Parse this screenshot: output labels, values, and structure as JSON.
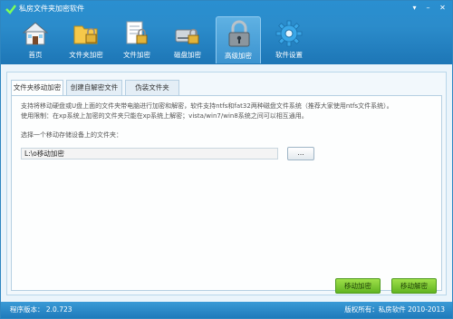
{
  "window": {
    "title": "私房文件夹加密软件",
    "controls": [
      "▾",
      "–",
      "✕"
    ]
  },
  "toolbar": {
    "items": [
      {
        "label": "首页",
        "icon": "house-icon"
      },
      {
        "label": "文件夹加密",
        "icon": "folder-lock-icon"
      },
      {
        "label": "文件加密",
        "icon": "document-lock-icon"
      },
      {
        "label": "磁盘加密",
        "icon": "disk-lock-icon"
      },
      {
        "label": "高级加密",
        "icon": "advanced-lock-icon",
        "active": true
      },
      {
        "label": "软件设置",
        "icon": "gear-icon"
      }
    ]
  },
  "tabs": [
    {
      "label": "文件夹移动加密",
      "active": true
    },
    {
      "label": "创建自解密文件"
    },
    {
      "label": "伪装文件夹"
    }
  ],
  "panel": {
    "description_line1": "支持将移动硬盘或U盘上面的文件夹带电脑进行加密和解密，软件支持ntfs和fat32两种磁盘文件系统（推荐大家使用ntfs文件系统）。",
    "description_line2": "使用限制：在xp系统上加密的文件夹只能在xp系统上解密；vista/win7/win8系统之间可以相互通用。",
    "field_label": "选择一个移动存储设备上的文件夹：",
    "path_value": "L:\\o移动加密",
    "browse_label": "...",
    "encrypt_button": "移动加密",
    "decrypt_button": "移动解密"
  },
  "status": {
    "version": "程序版本：   2.0.723",
    "copyright": "版权所有：私房软件  2010-2013"
  },
  "colors": {
    "header": "#2b8ccb",
    "accent_green": "#62b421",
    "status_bar": "#2a8bcb"
  }
}
